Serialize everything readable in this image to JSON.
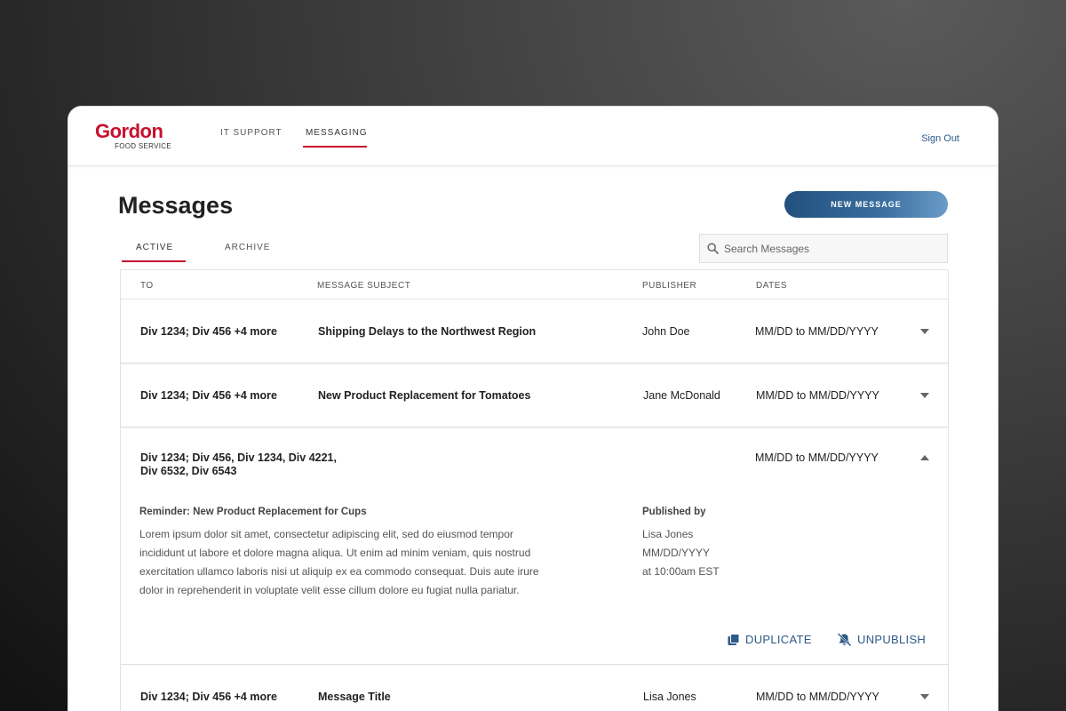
{
  "brand": {
    "name": "Gordon",
    "sub": "FOOD SERVICE",
    "color": "#c8102e"
  },
  "nav": {
    "items": [
      {
        "label": "IT SUPPORT"
      },
      {
        "label": "MESSAGING"
      }
    ],
    "active": "MESSAGING",
    "signout": "Sign Out"
  },
  "page": {
    "title": "Messages",
    "new_button": "NEW MESSAGE"
  },
  "tabs": [
    {
      "label": "ACTIVE"
    },
    {
      "label": "ARCHIVE"
    }
  ],
  "search": {
    "placeholder": "Search Messages"
  },
  "table": {
    "headers": {
      "to": "TO",
      "subject": "MESSAGE SUBJECT",
      "publisher": "PUBLISHER",
      "dates": "DATES"
    },
    "rows": [
      {
        "to": "Div 1234; Div 456 +4 more",
        "subject": "Shipping Delays to the Northwest Region",
        "publisher": "John Doe",
        "dates": "MM/DD to MM/DD/YYYY"
      },
      {
        "to": "Div 1234; Div 456 +4 more",
        "subject": "New Product Replacement for Tomatoes",
        "publisher": "Jane McDonald",
        "dates": "MM/DD to MM/DD/YYYY"
      },
      {
        "to_line1": "Div 1234; Div 456, Div 1234, Div 4221,",
        "to_line2": "Div 6532, Div 6543",
        "dates": "MM/DD to MM/DD/YYYY",
        "subject": "Reminder: New Product Replacement for Cups",
        "body_lines": [
          "Lorem ipsum dolor sit amet, consectetur adipiscing elit, sed do eiusmod tempor",
          "incididunt ut labore et dolore magna aliqua. Ut enim ad minim veniam, quis nostrud",
          "exercitation ullamco laboris nisi ut aliquip ex ea commodo consequat. Duis aute irure",
          "dolor in reprehenderit in voluptate velit esse cillum dolore eu fugiat nulla pariatur."
        ],
        "published_label": "Published by",
        "publisher": "Lisa Jones",
        "pub_date": "MM/DD/YYYY",
        "pub_time": "at 10:00am EST",
        "actions": {
          "duplicate": "DUPLICATE",
          "unpublish": "UNPUBLISH"
        }
      },
      {
        "to": "Div 1234; Div 456 +4 more",
        "subject": "Message Title",
        "publisher": "Lisa Jones",
        "dates": "MM/DD to MM/DD/YYYY"
      }
    ]
  },
  "colors": {
    "accent_red": "#c8102e",
    "link_blue": "#2d5a87"
  }
}
